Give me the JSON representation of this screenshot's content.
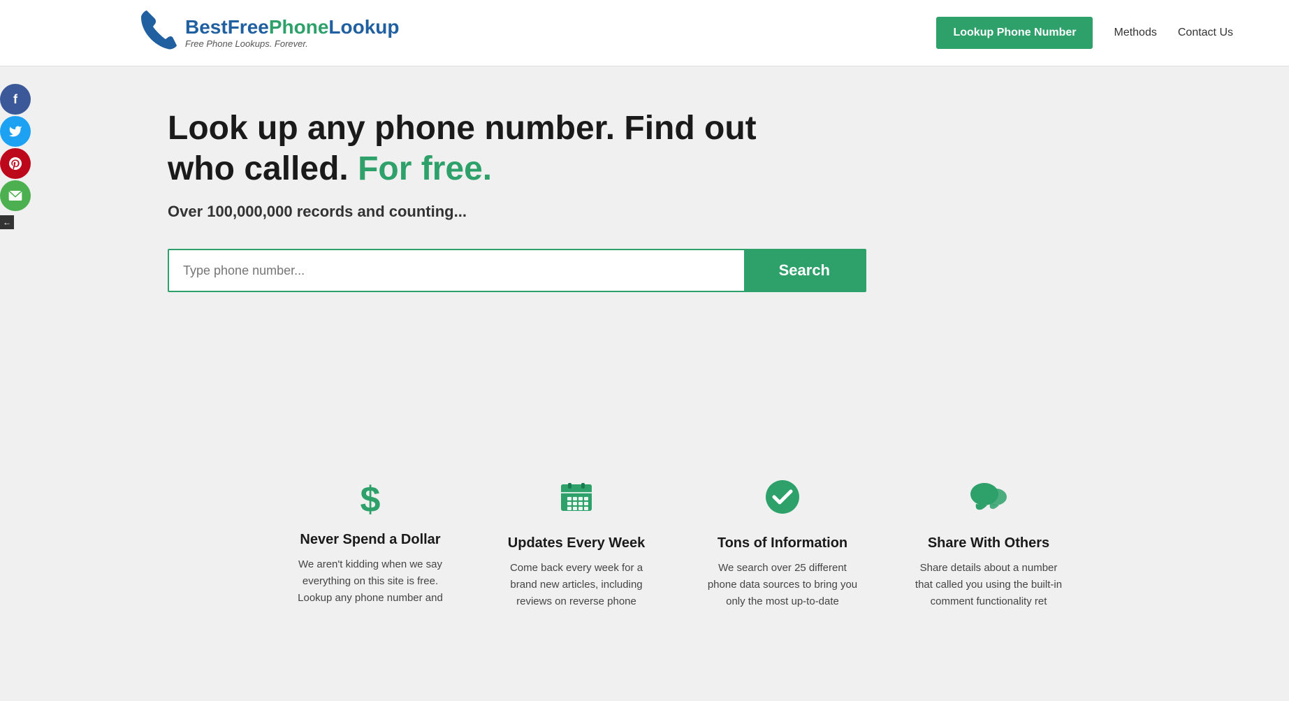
{
  "header": {
    "logo": {
      "best": "Best",
      "free": "Free",
      "phone": "Phone",
      "lookup": "Lookup",
      "tagline": "Free Phone Lookups. Forever."
    },
    "nav": {
      "lookup_btn": "Lookup Phone Number",
      "methods_link": "Methods",
      "contact_link": "Contact Us"
    }
  },
  "social": {
    "facebook": "f",
    "twitter": "t",
    "pinterest": "p",
    "email": "✉"
  },
  "hero": {
    "headline_part1": "Look up any phone number. Find out who called.",
    "headline_free": "For free.",
    "subtext": "Over 100,000,000 records and counting...",
    "search_placeholder": "Type phone number...",
    "search_btn": "Search"
  },
  "features": [
    {
      "id": "never-spend",
      "icon": "$",
      "icon_name": "dollar-icon",
      "title": "Never Spend a Dollar",
      "desc": "We aren't kidding when we say everything on this site is free. Lookup any phone number and"
    },
    {
      "id": "updates",
      "icon": "📅",
      "icon_name": "calendar-icon",
      "title": "Updates Every Week",
      "desc": "Come back every week for a brand new articles, including reviews on reverse phone"
    },
    {
      "id": "tons-info",
      "icon": "✔",
      "icon_name": "check-icon",
      "title": "Tons of Information",
      "desc": "We search over 25 different phone data sources to bring you only the most up-to-date"
    },
    {
      "id": "share-others",
      "icon": "💬",
      "icon_name": "chat-icon",
      "title": "Share With Others",
      "desc": "Share details about a number that called you using the built-in comment functionality ret"
    }
  ]
}
